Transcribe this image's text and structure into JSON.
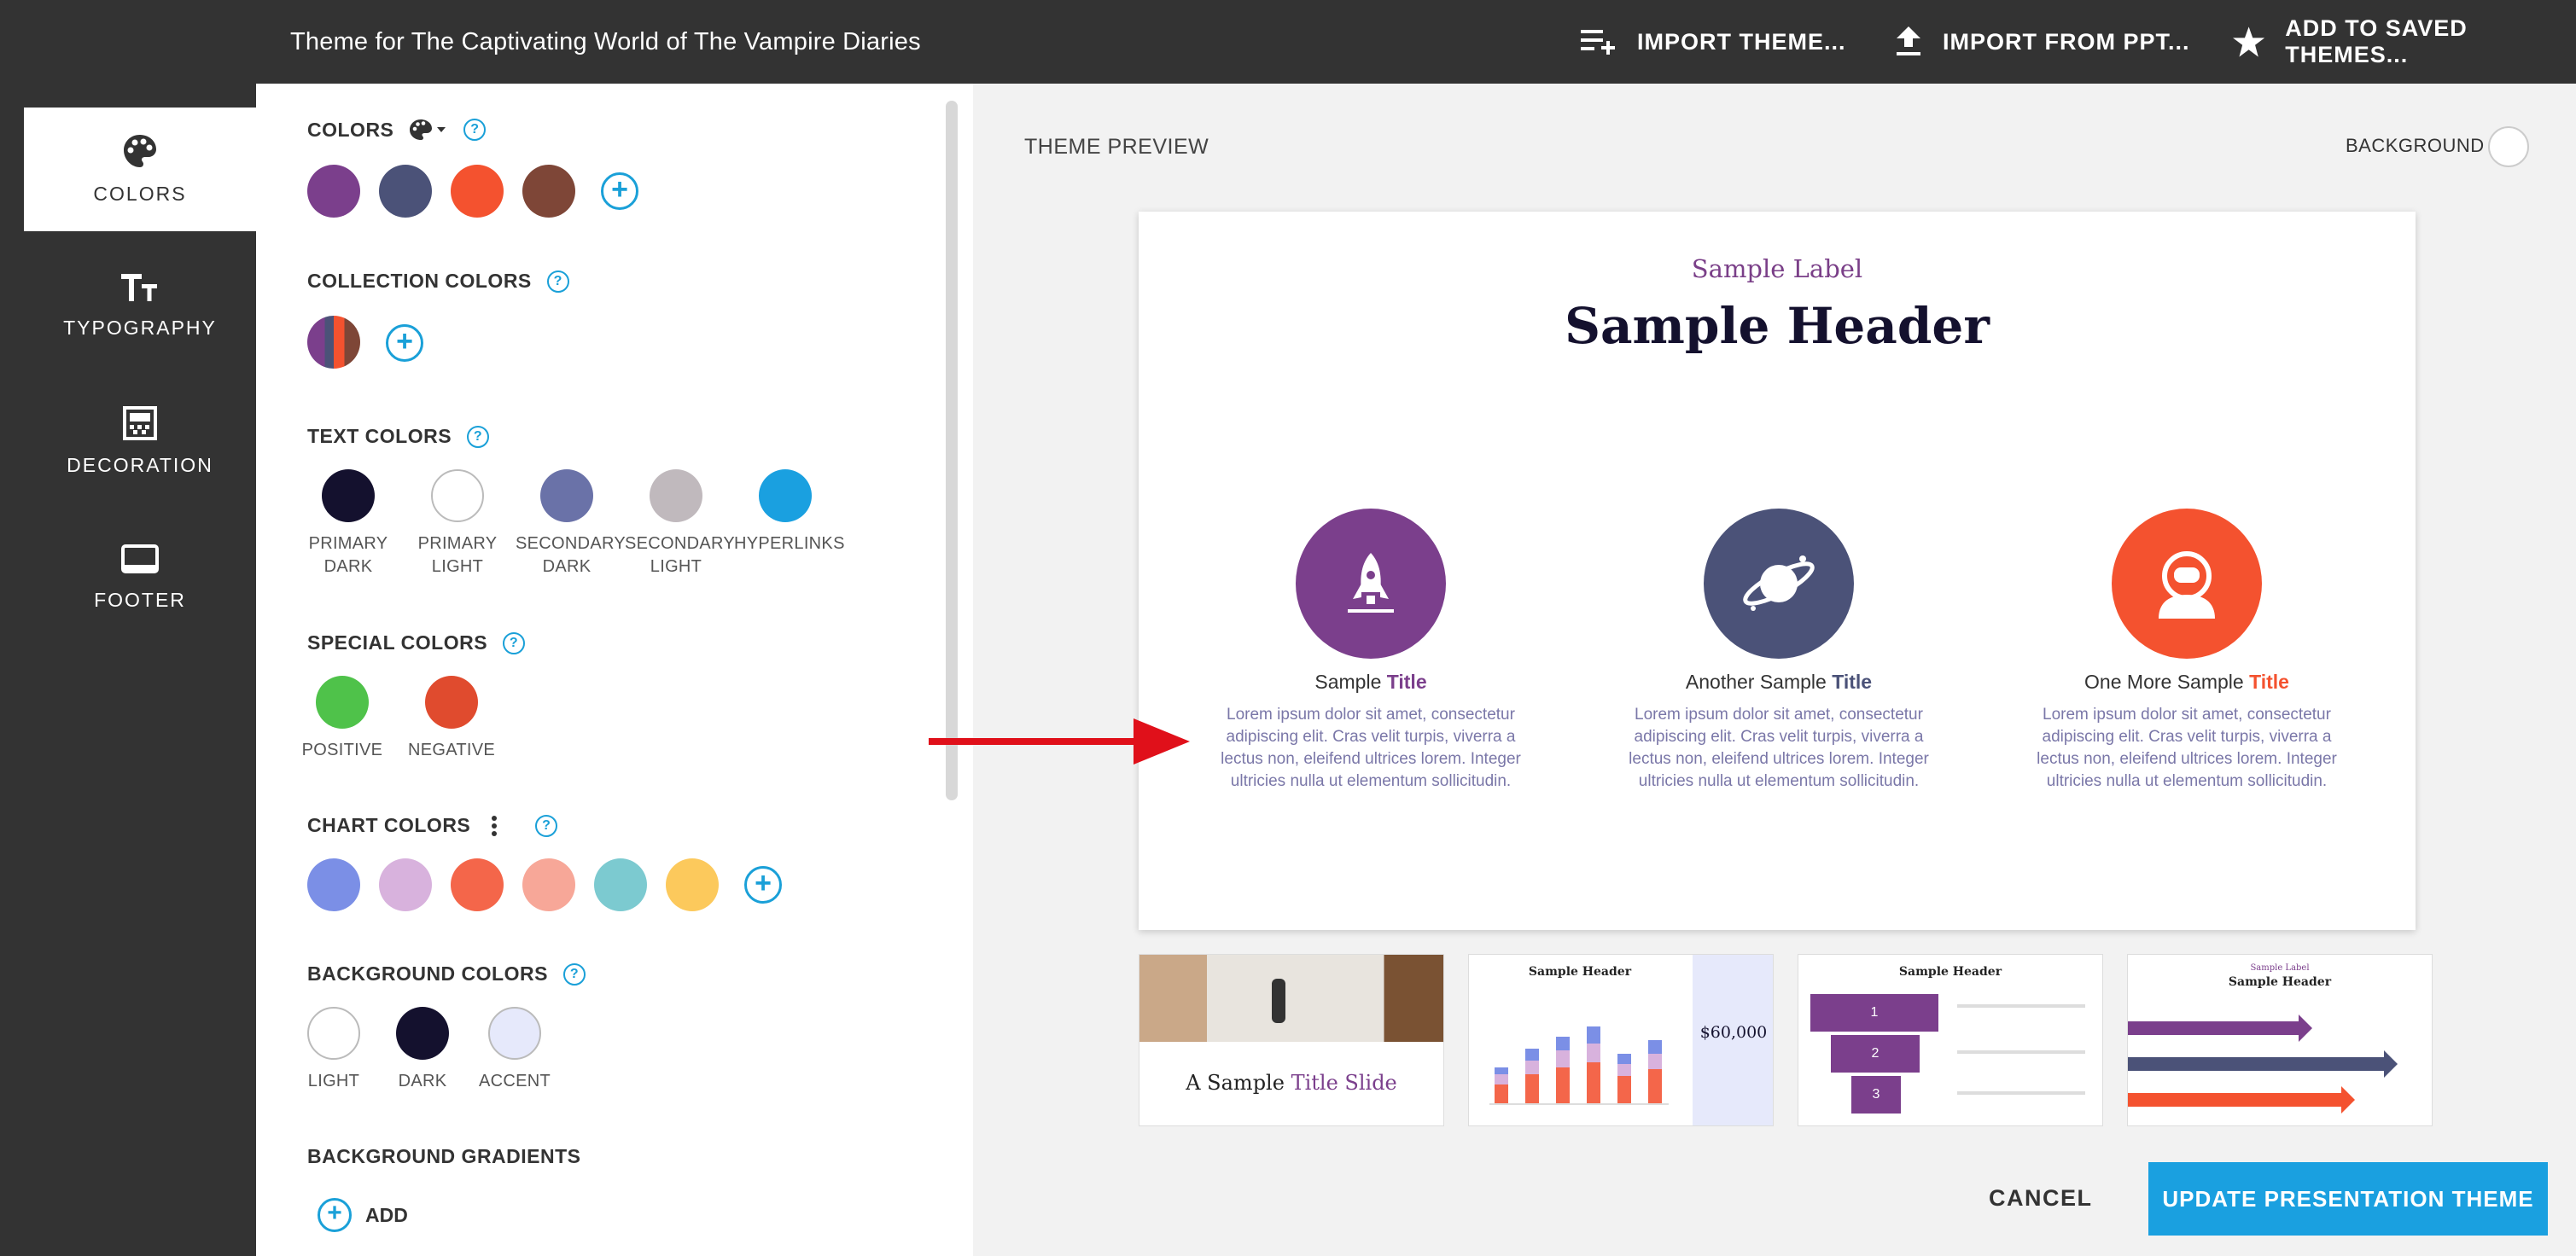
{
  "header": {
    "title": "Theme for The Captivating World of The Vampire Diaries",
    "actions": {
      "import_theme": "IMPORT THEME...",
      "import_ppt": "IMPORT FROM PPT...",
      "save_theme": "ADD TO SAVED THEMES..."
    }
  },
  "nav": {
    "items": [
      {
        "label": "COLORS",
        "icon": "palette-icon"
      },
      {
        "label": "TYPOGRAPHY",
        "icon": "text-size-icon"
      },
      {
        "label": "DECORATION",
        "icon": "decoration-icon"
      },
      {
        "label": "FOOTER",
        "icon": "footer-icon"
      }
    ]
  },
  "panel": {
    "colors": {
      "label": "COLORS",
      "swatches": [
        "#7b3f8c",
        "#4b5278",
        "#f4522f",
        "#7e4637"
      ]
    },
    "collection": {
      "label": "COLLECTION COLORS"
    },
    "text_colors": {
      "label": "TEXT COLORS",
      "items": [
        {
          "cap1": "PRIMARY",
          "cap2": "DARK",
          "color": "#14112e"
        },
        {
          "cap1": "PRIMARY",
          "cap2": "LIGHT",
          "color": "#ffffff"
        },
        {
          "cap1": "SECONDARY",
          "cap2": "DARK",
          "color": "#6a72a8"
        },
        {
          "cap1": "SECONDARY",
          "cap2": "LIGHT",
          "color": "#c0b9bd"
        },
        {
          "cap1": "HYPERLINKS",
          "cap2": "",
          "color": "#1aa0e0"
        }
      ]
    },
    "special_colors": {
      "label": "SPECIAL COLORS",
      "items": [
        {
          "cap": "POSITIVE",
          "color": "#4fc24a"
        },
        {
          "cap": "NEGATIVE",
          "color": "#e04b2e"
        }
      ]
    },
    "chart_colors": {
      "label": "CHART COLORS",
      "swatches": [
        "#7b8fe6",
        "#d8b2dd",
        "#f4664a",
        "#f7a798",
        "#7ccad0",
        "#fcc95c"
      ]
    },
    "background_colors": {
      "label": "BACKGROUND COLORS",
      "items": [
        {
          "cap": "LIGHT",
          "color": "#ffffff"
        },
        {
          "cap": "DARK",
          "color": "#14112e"
        },
        {
          "cap": "ACCENT",
          "color": "#e6e9fb"
        }
      ]
    },
    "gradients": {
      "label": "BACKGROUND GRADIENTS",
      "add_label": "ADD"
    }
  },
  "preview": {
    "label": "THEME PREVIEW",
    "background_label": "BACKGROUND",
    "slide": {
      "label": "Sample Label",
      "header": "Sample Header",
      "columns": [
        {
          "pre": "Sample ",
          "bold": "Title",
          "color": "#7b3f8c",
          "title_color": "#7b3f8c",
          "icon": "rocket-icon",
          "body": "Lorem ipsum dolor sit amet, consectetur adipiscing elit. Cras velit turpis, viverra a lectus non, eleifend ultrices lorem. Integer ultricies nulla ut elementum sollicitudin."
        },
        {
          "pre": "Another Sample ",
          "bold": "Title",
          "color": "#4b5278",
          "title_color": "#4b5278",
          "icon": "planet-icon",
          "body": "Lorem ipsum dolor sit amet, consectetur adipiscing elit. Cras velit turpis, viverra a lectus non, eleifend ultrices lorem. Integer ultricies nulla ut elementum sollicitudin."
        },
        {
          "pre": "One More Sample ",
          "bold": "Title",
          "color": "#f4522f",
          "title_color": "#f4522f",
          "icon": "astronaut-icon",
          "body": "Lorem ipsum dolor sit amet, consectetur adipiscing elit. Cras velit turpis, viverra a lectus non, eleifend ultrices lorem. Integer ultricies nulla ut elementum sollicitudin."
        }
      ]
    },
    "thumbnails": {
      "t1": {
        "pre": "A Sample ",
        "bold": "Title Slide"
      },
      "t2": {
        "title": "Sample Header",
        "value": "$60,000"
      },
      "t3": {
        "title": "Sample Header",
        "steps": [
          "1",
          "2",
          "3"
        ]
      },
      "t4": {
        "label": "Sample Label",
        "title": "Sample Header"
      }
    }
  },
  "footer": {
    "cancel": "CANCEL",
    "update": "UPDATE PRESENTATION THEME"
  }
}
